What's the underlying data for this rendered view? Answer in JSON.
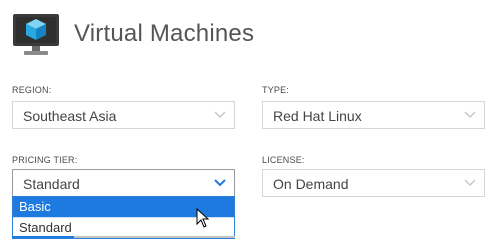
{
  "header": {
    "title": "Virtual Machines",
    "icon": "virtual-machine-icon"
  },
  "fields": {
    "region": {
      "label": "REGION:",
      "value": "Southeast Asia"
    },
    "type": {
      "label": "TYPE:",
      "value": "Red Hat Linux"
    },
    "pricing_tier": {
      "label": "PRICING TIER:",
      "value": "Standard"
    },
    "license": {
      "label": "LICENSE:",
      "value": "On Demand"
    }
  },
  "pricing_tier_dropdown": {
    "options": [
      "Basic",
      "Standard"
    ],
    "highlighted": "Basic"
  },
  "colors": {
    "accent": "#1f7ae0",
    "icon_blue": "#27a9e1"
  }
}
